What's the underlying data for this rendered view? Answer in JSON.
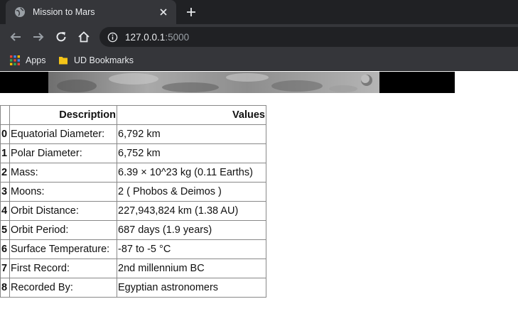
{
  "browser": {
    "tab": {
      "title": "Mission to Mars"
    },
    "address": {
      "host": "127.0.0.1",
      "port": ":5000"
    },
    "bookmarks": [
      {
        "label": "Apps"
      },
      {
        "label": "UD Bookmarks"
      }
    ]
  },
  "facts_table": {
    "columns": [
      "",
      "Description",
      "Values"
    ],
    "rows": [
      {
        "index": "0",
        "description": "Equatorial Diameter:",
        "value": "6,792 km"
      },
      {
        "index": "1",
        "description": "Polar Diameter:",
        "value": "6,752 km"
      },
      {
        "index": "2",
        "description": "Mass:",
        "value": "6.39 × 10^23 kg (0.11 Earths)"
      },
      {
        "index": "3",
        "description": "Moons:",
        "value": "2 ( Phobos & Deimos )"
      },
      {
        "index": "4",
        "description": "Orbit Distance:",
        "value": "227,943,824 km (1.38 AU)"
      },
      {
        "index": "5",
        "description": "Orbit Period:",
        "value": "687 days (1.9 years)"
      },
      {
        "index": "6",
        "description": "Surface Temperature:",
        "value": "-87 to -5 °C"
      },
      {
        "index": "7",
        "description": "First Record:",
        "value": "2nd millennium BC"
      },
      {
        "index": "8",
        "description": "Recorded By:",
        "value": "Egyptian astronomers"
      }
    ]
  }
}
